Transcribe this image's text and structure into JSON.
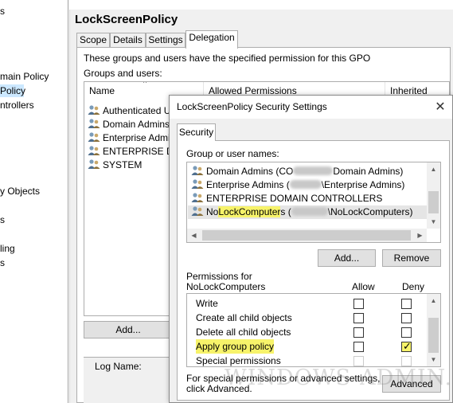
{
  "left_tree": {
    "items": [
      {
        "label": "s"
      },
      {
        "label": "main Policy"
      },
      {
        "label": "Policy",
        "selected": true
      },
      {
        "label": "ntrollers"
      },
      {
        "label": "y Objects"
      },
      {
        "label": "s"
      },
      {
        "label": "ling"
      },
      {
        "label": "s"
      }
    ]
  },
  "gpo": {
    "title": "LockScreenPolicy",
    "tabs": [
      {
        "label": "Scope"
      },
      {
        "label": "Details"
      },
      {
        "label": "Settings"
      },
      {
        "label": "Delegation",
        "active": true
      }
    ],
    "description": "These groups and users have the specified permission for this GPO",
    "groups_label": "Groups and users:",
    "columns": [
      "Name",
      "Allowed Permissions",
      "Inherited"
    ],
    "groups": [
      {
        "name": "Authenticated Use",
        "icon": "users-icon"
      },
      {
        "name": "Domain Admins (C",
        "icon": "users-icon"
      },
      {
        "name": "Enterprise Admins",
        "icon": "users-icon"
      },
      {
        "name": "ENTERPRISE DO",
        "icon": "users-icon"
      },
      {
        "name": "SYSTEM",
        "icon": "users-icon"
      }
    ],
    "add_button": "Add...",
    "log_name_label": "Log Name:"
  },
  "dialog": {
    "title": "LockScreenPolicy Security Settings",
    "close_glyph": "✕",
    "tab": "Security",
    "users_label": "Group or user names:",
    "users": [
      {
        "prefix": "Domain Admins (CO",
        "suffix": "Domain Admins)",
        "redacted": true
      },
      {
        "prefix": "Enterprise Admins (",
        "suffix": "\\Enterprise Admins)",
        "redacted": true
      },
      {
        "prefix": "ENTERPRISE DOMAIN CONTROLLERS",
        "suffix": "",
        "redacted": false
      },
      {
        "prefix": "No",
        "highlight": "LockComputer",
        "prefix2": "s (",
        "suffix": "\\NoLockComputers)",
        "redacted": true,
        "selected": true
      }
    ],
    "add_button": "Add...",
    "remove_button": "Remove",
    "permissions_label_1": "Permissions for",
    "permissions_label_2": "NoLockComputers",
    "allow_header": "Allow",
    "deny_header": "Deny",
    "permissions": [
      {
        "name": "Write",
        "allow": false,
        "deny": false
      },
      {
        "name": "Create all child objects",
        "allow": false,
        "deny": false
      },
      {
        "name": "Delete all child objects",
        "allow": false,
        "deny": false
      },
      {
        "name": "Apply group policy",
        "allow": false,
        "deny": true,
        "highlight": true
      },
      {
        "name": "Special permissions",
        "allow": false,
        "deny": false,
        "disabled": true
      }
    ],
    "special_text_1": "For special permissions or advanced settings,",
    "special_text_2": "click Advanced.",
    "advanced_button": "Advanced",
    "highlight_color": "#f7f36a"
  },
  "watermark": "WINDOWS-ADMIN.COM"
}
